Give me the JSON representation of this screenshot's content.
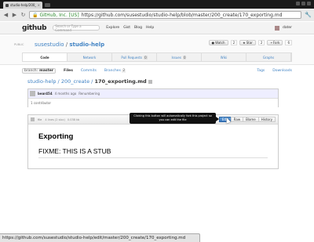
{
  "browser": {
    "tab_title": "studio-help/200_create/",
    "tab_close": "×",
    "back": "◀",
    "forward": "▶",
    "reload": "↻",
    "url_cert": "GitHub, Inc. [US]",
    "url": "https://github.com/susestudio/studio-help/blob/master/200_create/170_exporting.md",
    "status_url": "https://github.com/susestudio/studio-help/edit/master/200_create/170_exporting.md"
  },
  "header": {
    "logo": "github",
    "search_placeholder": "Search or Type a Command",
    "nav": [
      "Explore",
      "Gist",
      "Blog",
      "Help"
    ],
    "username": "dater"
  },
  "repo": {
    "visibility": "PUBLIC",
    "owner": "susestudio",
    "sep": "/",
    "name": "studio-help",
    "watch_label": "Watch",
    "watch_count": "2",
    "star_label": "Star",
    "star_count": "2",
    "fork_label": "Fork",
    "fork_count": "6"
  },
  "repo_tabs": [
    {
      "label": "Code"
    },
    {
      "label": "Network"
    },
    {
      "label": "Pull Requests",
      "count": "0"
    },
    {
      "label": "Issues",
      "count": "0"
    },
    {
      "label": "Wiki"
    },
    {
      "label": "Graphs"
    }
  ],
  "subnav": {
    "branch_label": "branch:",
    "branch_name": "master",
    "files": "Files",
    "commits": "Commits",
    "branches": "Branches",
    "branches_count": "2",
    "tags": "Tags",
    "downloads": "Downloads"
  },
  "breadcrumb": {
    "repo": "studio-help",
    "sep": " / ",
    "dir": "200_create",
    "file": "170_exporting.md"
  },
  "commit": {
    "user": "bear454",
    "time": "4 months ago",
    "message": "Renumbering",
    "contributors": "1 contributor"
  },
  "file": {
    "mode": "file",
    "lines": "4 lines (2 sloc)",
    "size": "0.038 kb",
    "actions": [
      "Edit",
      "Raw",
      "Blame",
      "History"
    ],
    "tooltip": "Clicking this button will automatically fork this project so you can edit the file",
    "heading": "Exporting",
    "body": "FIXME: THIS IS A STUB"
  }
}
